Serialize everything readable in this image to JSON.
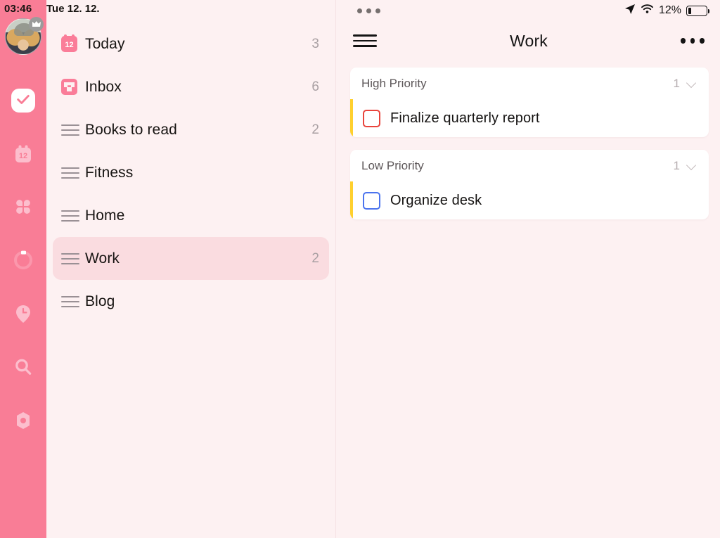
{
  "status_bar": {
    "time": "03:46",
    "date": "Tue 12. 12.",
    "battery_percent": "12%",
    "location_icon": "location-arrow-icon",
    "wifi_icon": "wifi-icon",
    "battery_icon": "battery-icon",
    "window_dots_icon": "window-dots-icon"
  },
  "rail": {
    "avatar_name": "user-avatar",
    "crown_badge": "crown-badge-icon",
    "items": [
      {
        "name": "tasks",
        "icon": "check-icon",
        "selected": true
      },
      {
        "name": "calendar",
        "icon": "calendar-12-icon",
        "selected": false
      },
      {
        "name": "widgets",
        "icon": "clover-grid-icon",
        "selected": false
      },
      {
        "name": "progress",
        "icon": "timer-ring-icon",
        "selected": false
      },
      {
        "name": "planned",
        "icon": "pin-clock-icon",
        "selected": false
      },
      {
        "name": "search",
        "icon": "search-icon",
        "selected": false
      },
      {
        "name": "settings",
        "icon": "settings-hex-icon",
        "selected": false
      }
    ]
  },
  "sidebar": {
    "items": [
      {
        "label": "Today",
        "count": "3",
        "icon": "calendar-12-icon",
        "active": false
      },
      {
        "label": "Inbox",
        "count": "6",
        "icon": "inbox-icon",
        "active": false
      },
      {
        "label": "Books to read",
        "count": "2",
        "icon": "list-lines-icon",
        "active": false
      },
      {
        "label": "Fitness",
        "count": "",
        "icon": "list-lines-icon",
        "active": false
      },
      {
        "label": "Home",
        "count": "",
        "icon": "list-lines-icon",
        "active": false
      },
      {
        "label": "Work",
        "count": "2",
        "icon": "list-lines-icon",
        "active": true
      },
      {
        "label": "Blog",
        "count": "",
        "icon": "list-lines-icon",
        "active": false
      }
    ]
  },
  "detail": {
    "title": "Work",
    "menu_icon": "hamburger-menu-icon",
    "overflow_icon": "more-options-icon",
    "sections": [
      {
        "name": "High Priority",
        "count": "1",
        "chevron": "chevron-down-icon",
        "accent": "#ffd02e",
        "tasks": [
          {
            "title": "Finalize quarterly report",
            "checkbox_color": "#e9443c",
            "checked": false
          }
        ]
      },
      {
        "name": "Low Priority",
        "count": "1",
        "chevron": "chevron-down-icon",
        "accent": "#ffd02e",
        "tasks": [
          {
            "title": "Organize desk",
            "checkbox_color": "#4b73ee",
            "checked": false
          }
        ]
      }
    ]
  },
  "colors": {
    "rail_pink": "#f97d96",
    "background": "#fdf1f2",
    "active_row": "#fadce0",
    "card": "#ffffff",
    "accent_yellow": "#ffd02e",
    "red": "#e9443c",
    "blue": "#4b73ee"
  }
}
